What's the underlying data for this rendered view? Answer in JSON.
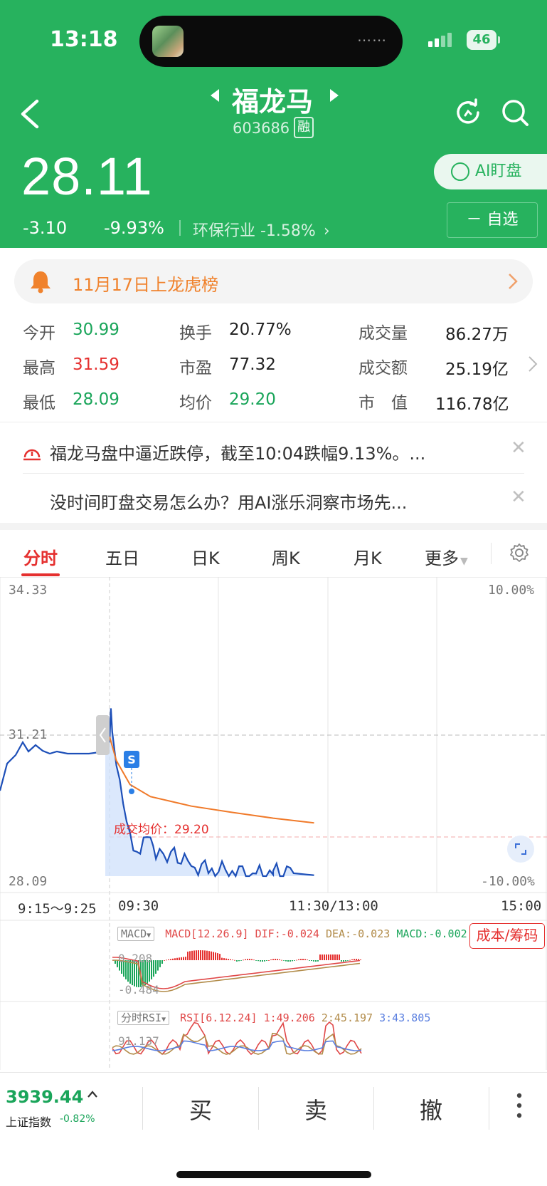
{
  "status": {
    "time": "13:18",
    "battery": "46"
  },
  "header": {
    "name": "福龙马",
    "code": "603686",
    "rong": "融",
    "price": "28.11",
    "change": "-3.10",
    "change_pct": "-9.93%",
    "industry": "环保行业 -1.58%",
    "ai_label": "AI盯盘",
    "fav_label": "－ 自选",
    "colors": {
      "header_bg": "#27b25e",
      "up": "#e5302f",
      "down": "#1aa55a",
      "notice": "#f0822c"
    }
  },
  "notice": {
    "text": "11月17日上龙虎榜"
  },
  "quote": {
    "open_label": "今开",
    "open": "30.99",
    "high_label": "最高",
    "high": "31.59",
    "low_label": "最低",
    "low": "28.09",
    "turnover_label": "换手",
    "turnover": "20.77%",
    "pe_label": "市盈",
    "pe": "77.32",
    "avg_label": "均价",
    "avg": "29.20",
    "volume_label": "成交量",
    "volume": "86.27万",
    "amount_label": "成交额",
    "amount": "25.19亿",
    "mktcap_label": "市　值",
    "mktcap": "116.78亿"
  },
  "news": [
    {
      "text": "福龙马盘中逼近跌停，截至10:04跌幅9.13%。..."
    },
    {
      "text": "没时间盯盘交易怎么办？用AI涨乐洞察市场先..."
    }
  ],
  "tabs": [
    "分时",
    "五日",
    "日K",
    "周K",
    "月K",
    "更多"
  ],
  "chart": {
    "y_top": "34.33",
    "y_mid": "31.21",
    "y_bottom": "28.09",
    "pct_top": "10.00%",
    "pct_bottom": "-10.00%",
    "avg_price_label": "成交均价：29.20",
    "sell_marker": "S",
    "times": [
      "9:15～9:25",
      "09:30",
      "11:30/13:00",
      "15:00"
    ]
  },
  "macd": {
    "selector": "MACD",
    "params": "MACD[12.26.9]",
    "dif": "DIF:-0.024",
    "dea": "DEA:-0.023",
    "macd": "MACD:-0.002",
    "top": "0.208",
    "bottom": "-0.484",
    "cost_label": "成本/筹码"
  },
  "rsi": {
    "selector": "分时RSI",
    "params": "RSI[6.12.24]",
    "rsi1": "1:49.206",
    "rsi2": "2:45.197",
    "rsi3": "3:43.805",
    "top": "91.137"
  },
  "bottom": {
    "index_value": "3939.44",
    "index_name": "上证指数",
    "index_change": "-0.82%",
    "buy": "买",
    "sell": "卖",
    "cancel": "撤"
  },
  "chart_data": {
    "type": "line",
    "title": "",
    "xlabel": "",
    "ylabel": "",
    "ylim": [
      28.09,
      34.33
    ],
    "series": [
      {
        "name": "",
        "x": [
          "09:25",
          "09:30",
          "09:31",
          "09:32",
          "09:35",
          "09:40",
          "09:45",
          "09:50",
          "10:00",
          "10:04",
          "10:15",
          "10:30",
          "10:45",
          "11:00",
          "11:15",
          "11:30",
          "13:00",
          "13:15",
          "13:30"
        ],
        "values": [
          30.75,
          30.9,
          31.59,
          31.1,
          30.4,
          29.6,
          29.0,
          28.6,
          28.9,
          28.45,
          28.6,
          28.3,
          28.25,
          28.2,
          28.15,
          28.12,
          28.2,
          28.15,
          28.11
        ]
      },
      {
        "name": "成交均价",
        "x": [
          "09:30",
          "09:35",
          "09:45",
          "10:00",
          "10:30",
          "11:00",
          "11:30",
          "13:30"
        ],
        "values": [
          31.0,
          30.5,
          30.0,
          29.75,
          29.55,
          29.42,
          29.3,
          29.2
        ]
      }
    ]
  }
}
